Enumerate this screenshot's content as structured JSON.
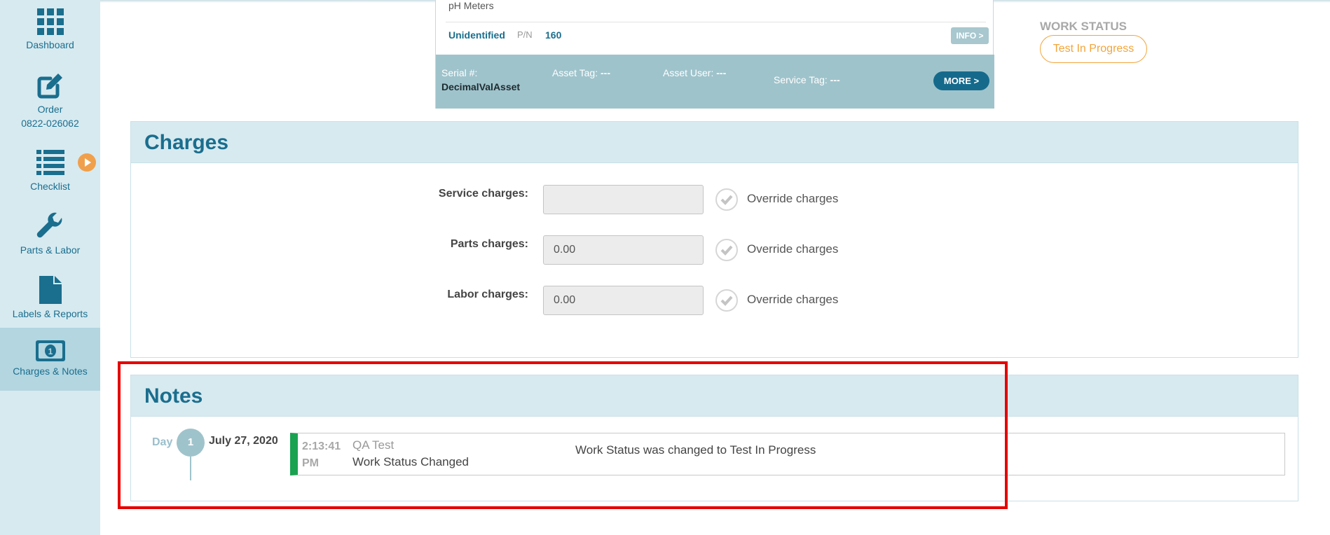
{
  "sidebar": {
    "items": [
      {
        "label": "Dashboard",
        "icon": "grid-icon"
      },
      {
        "label": "Order",
        "sublabel": "0822-026062",
        "icon": "edit-icon"
      },
      {
        "label": "Checklist",
        "icon": "list-icon"
      },
      {
        "label": "Parts & Labor",
        "icon": "wrench-icon"
      },
      {
        "label": "Labels & Reports",
        "icon": "document-icon"
      },
      {
        "label": "Charges & Notes",
        "icon": "money-icon",
        "active": true
      }
    ]
  },
  "asset": {
    "type": "pH Meters",
    "id": "Unidentified",
    "pn_label": "P/N",
    "pn": "160",
    "info_label": "INFO >",
    "serial_label": "Serial #:",
    "serial": "DecimalValAsset",
    "asset_tag_label": "Asset Tag:",
    "asset_tag": "---",
    "asset_user_label": "Asset User:",
    "asset_user": "---",
    "service_tag_label": "Service Tag:",
    "service_tag": "---",
    "more_label": "MORE >"
  },
  "work_status": {
    "title": "WORK STATUS",
    "value": "Test In Progress",
    "color": "#f2a53c"
  },
  "charges": {
    "title": "Charges",
    "rows": [
      {
        "label": "Service charges:",
        "value": "",
        "override": "Override charges"
      },
      {
        "label": "Parts charges:",
        "value": "0.00",
        "override": "Override charges"
      },
      {
        "label": "Labor charges:",
        "value": "0.00",
        "override": "Override charges"
      }
    ]
  },
  "notes": {
    "title": "Notes",
    "day_label": "Day",
    "day_number": "1",
    "date": "July 27, 2020",
    "entries": [
      {
        "time": "2:13:41",
        "ampm": "PM",
        "user": "QA Test",
        "type": "Work Status Changed",
        "text": "Work Status was changed to Test In Progress",
        "accent": "#1aa251"
      }
    ]
  },
  "theme": {
    "primary": "#1a6e8e",
    "sidebar_bg": "#d7eaf0",
    "highlight": "#e60000"
  }
}
